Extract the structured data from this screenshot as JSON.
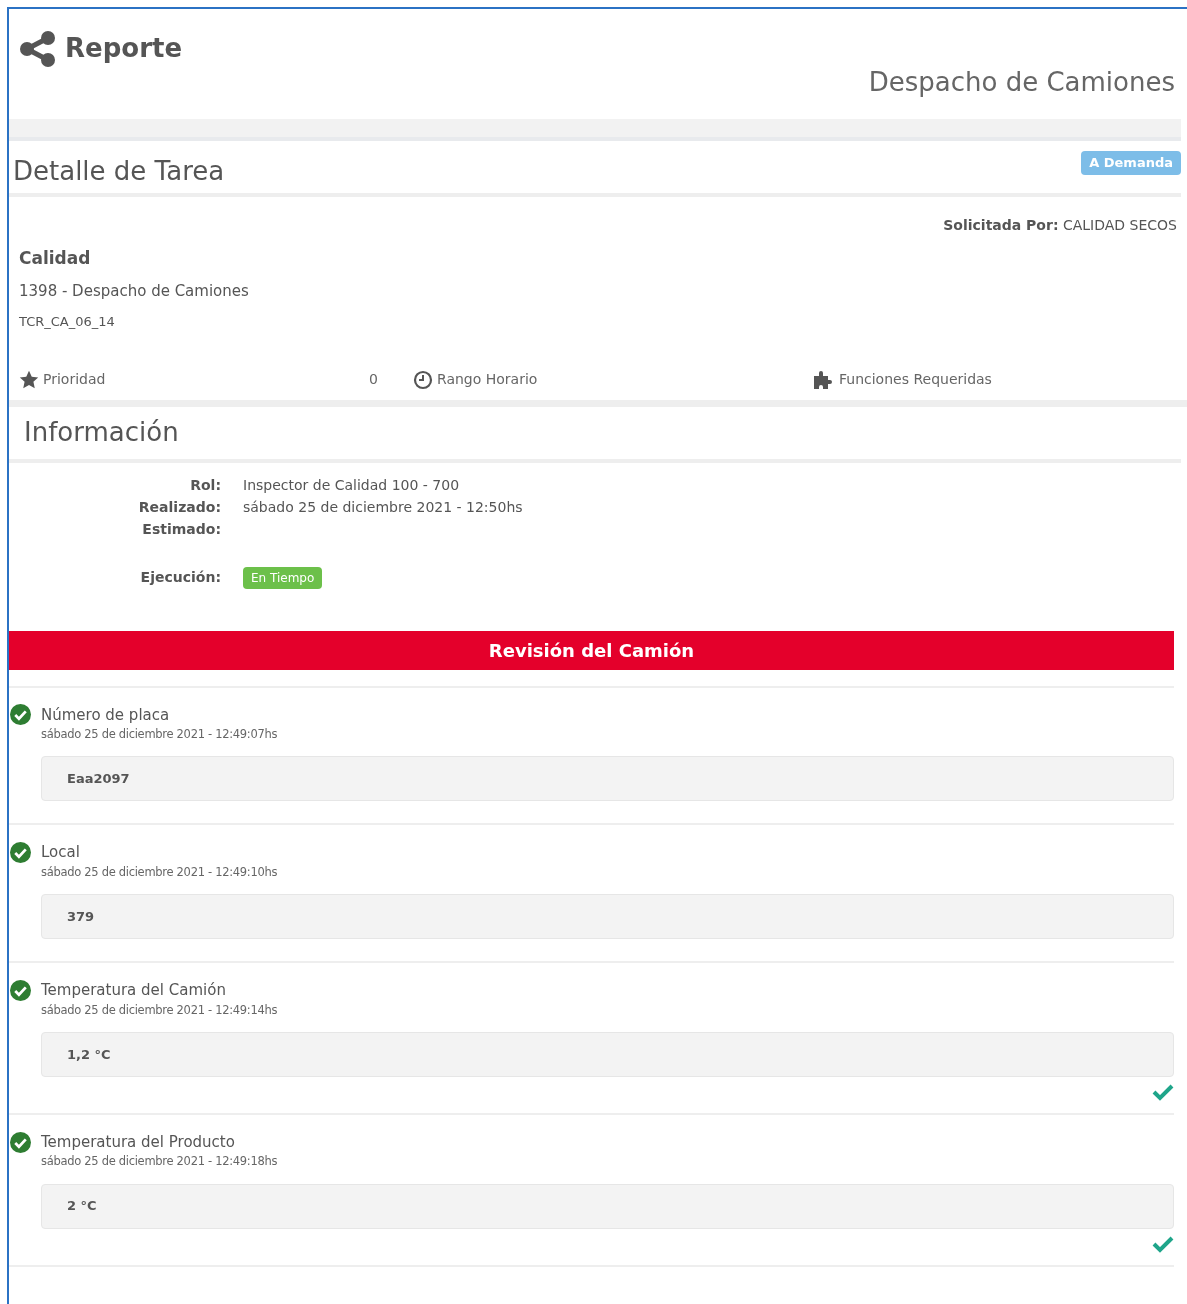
{
  "header": {
    "title": "Reporte",
    "subtitle": "Despacho de Camiones"
  },
  "task": {
    "title": "Detalle de Tarea",
    "badge": "A Demanda",
    "requested_by_label": "Solicitada Por:",
    "requested_by": "CALIDAD SECOS",
    "category": "Calidad",
    "process": "1398 - Despacho de Camiones",
    "code": "TCR_CA_06_14",
    "priority_label": "Prioridad",
    "priority": "0",
    "time_range_label": "Rango Horario",
    "functions_label": "Funciones Requeridas"
  },
  "info": {
    "title": "Información",
    "rows": [
      {
        "label": "Rol:",
        "value": "Inspector de Calidad 100 - 700"
      },
      {
        "label": "Realizado:",
        "value": "sábado 25 de diciembre 2021 - 12:50hs"
      },
      {
        "label": "Estimado:"
      }
    ],
    "execution_label": "Ejecución:",
    "execution": "En Tiempo"
  },
  "review": {
    "title": "Revisión del Camión",
    "items": [
      {
        "label": "Número de placa",
        "time": "sábado 25 de diciembre 2021 - 12:49:07hs",
        "value": "Eaa2097",
        "done": true,
        "approved": false
      },
      {
        "label": "Local",
        "time": "sábado 25 de diciembre 2021 - 12:49:10hs",
        "value": "379",
        "done": true,
        "approved": false
      },
      {
        "label": "Temperatura del Camión",
        "time": "sábado 25 de diciembre 2021 - 12:49:14hs",
        "value": "1,2 °C",
        "done": true,
        "approved": true
      },
      {
        "label": "Temperatura del Producto",
        "time": "sábado 25 de diciembre 2021 - 12:49:18hs",
        "value": "2 °C",
        "done": true,
        "approved": true
      }
    ]
  }
}
